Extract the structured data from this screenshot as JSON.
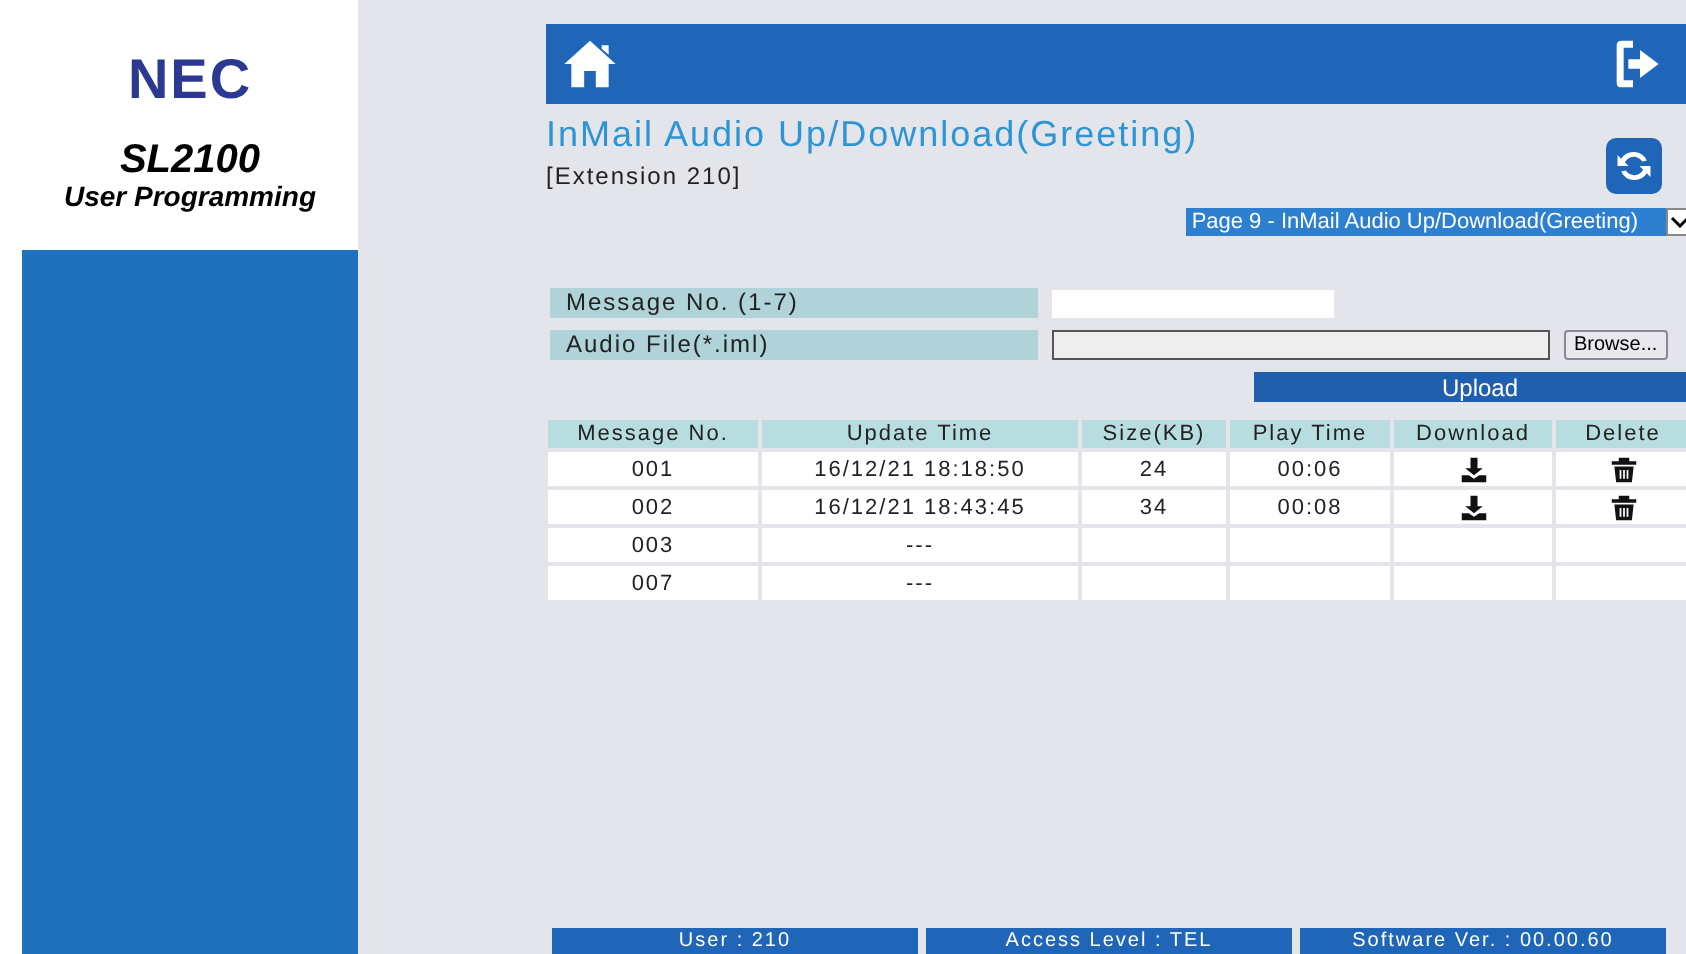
{
  "brand": {
    "logo": "NEC",
    "model": "SL2100",
    "subtitle": "User Programming"
  },
  "page": {
    "title": "InMail Audio Up/Download(Greeting)",
    "extension": "[Extension 210]",
    "page_select": "Page 9 - InMail Audio Up/Download(Greeting)"
  },
  "form": {
    "message_label": "Message No. (1-7)",
    "audio_label": "Audio File(*.iml)",
    "browse": "Browse...",
    "upload": "Upload"
  },
  "table": {
    "columns": [
      "Message No.",
      "Update Time",
      "Size(KB)",
      "Play Time",
      "Download",
      "Delete"
    ],
    "rows": [
      {
        "message": "001",
        "update_time": "16/12/21 18:18:50",
        "size": "24",
        "play_time": "00:06",
        "has_file": true
      },
      {
        "message": "002",
        "update_time": "16/12/21 18:43:45",
        "size": "34",
        "play_time": "00:08",
        "has_file": true
      },
      {
        "message": "003",
        "update_time": "---",
        "size": "",
        "play_time": "",
        "has_file": false
      },
      {
        "message": "007",
        "update_time": "---",
        "size": "",
        "play_time": "",
        "has_file": false
      }
    ]
  },
  "status_bar": [
    "User : 210",
    "Access Level : TEL",
    "Software Ver. : 00.00.60"
  ]
}
